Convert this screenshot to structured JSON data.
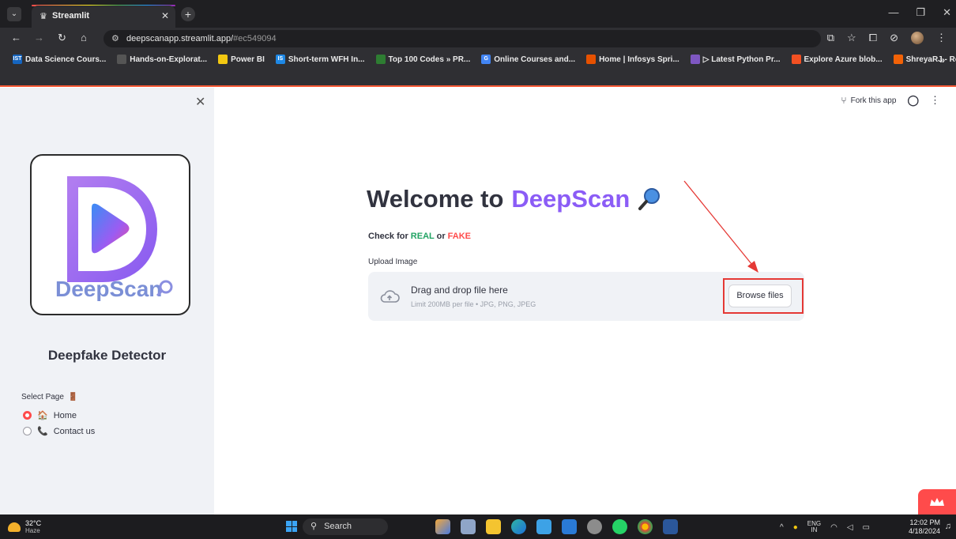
{
  "browser": {
    "tab_title": "Streamlit",
    "url_host": "deepscanapp.streamlit.app/",
    "url_hash": "#ec549094",
    "bookmarks": [
      {
        "label": "Data Science Cours...",
        "color": "#1565c0",
        "glyph": "IST"
      },
      {
        "label": "Hands-on-Explorat...",
        "color": "#555555",
        "glyph": ""
      },
      {
        "label": "Power BI",
        "color": "#f2c811",
        "glyph": ""
      },
      {
        "label": "Short-term WFH In...",
        "color": "#1e88e5",
        "glyph": "IS"
      },
      {
        "label": "Top 100 Codes » PR...",
        "color": "#2e7d32",
        "glyph": ""
      },
      {
        "label": "Online Courses and...",
        "color": "#4285f4",
        "glyph": "G"
      },
      {
        "label": "Home | Infosys Spri...",
        "color": "#e65100",
        "glyph": ""
      },
      {
        "label": "▷ Latest Python Pr...",
        "color": "#7e57c2",
        "glyph": ""
      },
      {
        "label": "Explore Azure blob...",
        "color": "#f25022",
        "glyph": ""
      },
      {
        "label": "ShreyaRJ - Replit",
        "color": "#f26207",
        "glyph": ""
      }
    ],
    "bookmarks_more": "»"
  },
  "sidebar": {
    "logo_text": "DeepScan",
    "title": "Deepfake Detector",
    "select_label": "Select Page",
    "options": [
      {
        "label": "Home",
        "checked": true
      },
      {
        "label": "Contact us",
        "checked": false
      }
    ]
  },
  "header": {
    "fork_label": "Fork this app"
  },
  "main": {
    "welcome": "Welcome to",
    "brand": "DeepScan",
    "check_prefix": "Check for ",
    "real": "REAL",
    "or": " or ",
    "fake": "FAKE",
    "upload_label": "Upload Image",
    "dropzone_title": "Drag and drop file here",
    "dropzone_limit": "Limit 200MB per file • JPG, PNG, JPEG",
    "browse_label": "Browse files"
  },
  "taskbar": {
    "temperature": "32°C",
    "weather": "Haze",
    "search_placeholder": "Search",
    "lang_top": "ENG",
    "lang_bottom": "IN",
    "time": "12:02 PM",
    "date": "4/18/2024"
  },
  "colors": {
    "accent_purple": "#8b5cf6",
    "streamlit_red": "#ff4b4b",
    "real_green": "#21a363"
  }
}
